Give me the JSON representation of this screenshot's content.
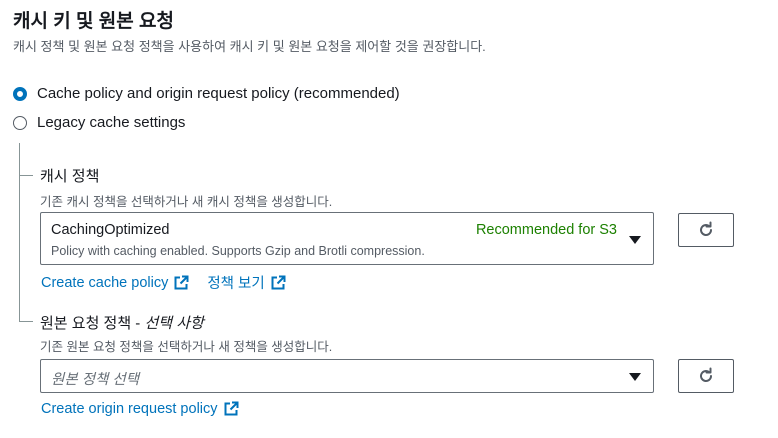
{
  "section": {
    "title": "캐시 키 및 원본 요청",
    "description": "캐시 정책 및 원본 요청 정책을 사용하여 캐시 키 및 원본 요청을 제어할 것을 권장합니다."
  },
  "options": {
    "recommended_label": "Cache policy and origin request policy (recommended)",
    "legacy_label": "Legacy cache settings",
    "selected": "recommended"
  },
  "cache_policy": {
    "label": "캐시 정책",
    "description": "기존 캐시 정책을 선택하거나 새 캐시 정책을 생성합니다.",
    "selected_name": "CachingOptimized",
    "selected_badge": "Recommended for S3",
    "selected_description": "Policy with caching enabled. Supports Gzip and Brotli compression.",
    "create_link": "Create cache policy",
    "view_link": "정책 보기"
  },
  "origin_policy": {
    "label": "원본 요청 정책 - ",
    "label_optional": "선택 사항",
    "description": "기존 원본 요청 정책을 선택하거나 새 정책을 생성합니다.",
    "placeholder": "원본 정책 선택",
    "create_link": "Create origin request policy"
  },
  "colors": {
    "link": "#0073bb",
    "badge": "#1d8102",
    "text": "#16191f",
    "muted": "#545b64"
  }
}
